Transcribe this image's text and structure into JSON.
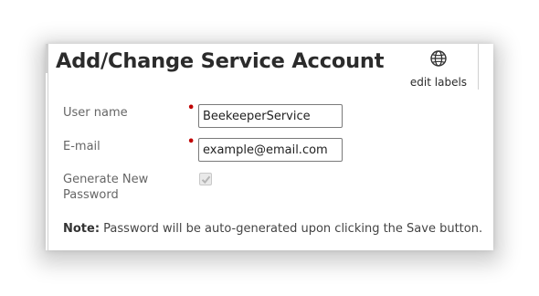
{
  "dialog": {
    "title": "Add/Change Service Account",
    "edit_labels": "edit labels",
    "edit_labels_icon": "globe-icon"
  },
  "form": {
    "username": {
      "label": "User name",
      "required_marker": "•",
      "value": "BeekeeperService"
    },
    "email": {
      "label": "E-mail",
      "required_marker": "•",
      "value": "example@email.com"
    },
    "generate_password": {
      "label": "Generate New Password",
      "checked": true,
      "disabled": true
    }
  },
  "note": {
    "prefix": "Note:",
    "text": " Password will be auto-generated upon clicking the Save button."
  },
  "colors": {
    "required": "#c00000",
    "label": "#666666",
    "title": "#2b2b2b"
  }
}
